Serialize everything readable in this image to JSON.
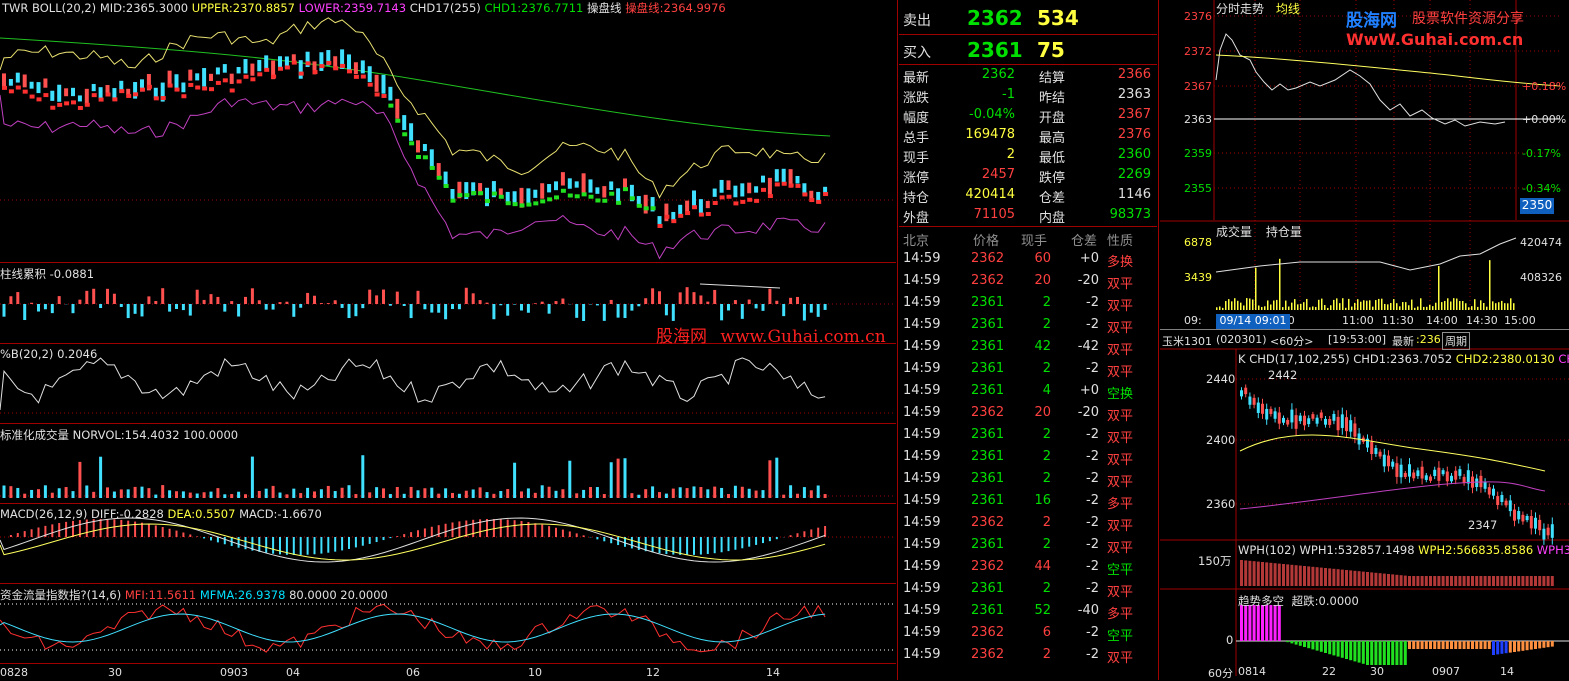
{
  "left_chart": {
    "boll_title": "TWR BOLL(20,2)",
    "mid": "MID:2365.3000",
    "upper": "UPPER:2370.8857",
    "lower": "LOWER:2359.7143",
    "chd": "CHD17(255)",
    "chd1": "CHD1:2376.7711",
    "op_line_label": "操盘线",
    "op_line_value": "操盘线:2364.9976",
    "vol_accum_label": "柱线累积",
    "vol_accum_value": "-0.0881",
    "pctb_label": "%B(20,2)",
    "pctb_value": "0.2046",
    "norvol_label": "标准化成交量",
    "norvol_value": "NORVOL:154.4032",
    "norvol_extra": "100.0000",
    "macd_label": "MACD(26,12,9)",
    "macd_diff": "DIFF:-0.2828",
    "macd_dea": "DEA:0.5507",
    "macd_val": "MACD:-1.6670",
    "mfi_label": "资金流量指数指?(14,6)",
    "mfi_value": "MFI:11.5611",
    "mfma_value": "MFMA:26.9378",
    "mfi_80": "80.0000",
    "mfi_20": "20.0000",
    "watermark_cn": "股海网",
    "watermark_url": "www.Guhai.com.cn",
    "x_labels": [
      "0828",
      "30",
      "0903",
      "04",
      "06",
      "10",
      "12",
      "14"
    ]
  },
  "quote": {
    "sell_label": "卖出",
    "sell_price": "2362",
    "sell_vol": "534",
    "buy_label": "买入",
    "buy_price": "2361",
    "buy_vol": "75",
    "rows": [
      {
        "l1": "最新",
        "v1": "2362",
        "l2": "结算",
        "v2": "2366"
      },
      {
        "l1": "涨跌",
        "v1": "-1",
        "l2": "昨结",
        "v2": "2363"
      },
      {
        "l1": "幅度",
        "v1": "-0.04%",
        "l2": "开盘",
        "v2": "2367"
      },
      {
        "l1": "总手",
        "v1": "169478",
        "l2": "最高",
        "v2": "2376"
      },
      {
        "l1": "现手",
        "v1": "2",
        "l2": "最低",
        "v2": "2360"
      },
      {
        "l1": "涨停",
        "v1": "2457",
        "l2": "跌停",
        "v2": "2269"
      },
      {
        "l1": "持仓",
        "v1": "420414",
        "l2": "仓差",
        "v2": "1146"
      },
      {
        "l1": "外盘",
        "v1": "71105",
        "l2": "内盘",
        "v2": "98373"
      }
    ],
    "tick_headers": [
      "北京",
      "价格",
      "现手",
      "仓差",
      "性质"
    ],
    "ticks": [
      {
        "t": "14:59",
        "p": "2362",
        "v": "60",
        "d": "+0",
        "n": "多换"
      },
      {
        "t": "14:59",
        "p": "2362",
        "v": "20",
        "d": "-20",
        "n": "双平"
      },
      {
        "t": "14:59",
        "p": "2361",
        "v": "2",
        "d": "-2",
        "n": "双平"
      },
      {
        "t": "14:59",
        "p": "2361",
        "v": "2",
        "d": "-2",
        "n": "双平"
      },
      {
        "t": "14:59",
        "p": "2361",
        "v": "42",
        "d": "-42",
        "n": "双平"
      },
      {
        "t": "14:59",
        "p": "2361",
        "v": "2",
        "d": "-2",
        "n": "双平"
      },
      {
        "t": "14:59",
        "p": "2361",
        "v": "4",
        "d": "+0",
        "n": "空换"
      },
      {
        "t": "14:59",
        "p": "2362",
        "v": "20",
        "d": "-20",
        "n": "双平"
      },
      {
        "t": "14:59",
        "p": "2361",
        "v": "2",
        "d": "-2",
        "n": "双平"
      },
      {
        "t": "14:59",
        "p": "2361",
        "v": "2",
        "d": "-2",
        "n": "双平"
      },
      {
        "t": "14:59",
        "p": "2361",
        "v": "2",
        "d": "-2",
        "n": "双平"
      },
      {
        "t": "14:59",
        "p": "2361",
        "v": "16",
        "d": "-2",
        "n": "多平"
      },
      {
        "t": "14:59",
        "p": "2362",
        "v": "2",
        "d": "-2",
        "n": "双平"
      },
      {
        "t": "14:59",
        "p": "2361",
        "v": "2",
        "d": "-2",
        "n": "双平"
      },
      {
        "t": "14:59",
        "p": "2362",
        "v": "44",
        "d": "-2",
        "n": "空平"
      },
      {
        "t": "14:59",
        "p": "2361",
        "v": "2",
        "d": "-2",
        "n": "双平"
      },
      {
        "t": "14:59",
        "p": "2361",
        "v": "52",
        "d": "-40",
        "n": "多平"
      },
      {
        "t": "14:59",
        "p": "2362",
        "v": "6",
        "d": "-2",
        "n": "空平"
      },
      {
        "t": "14:59",
        "p": "2362",
        "v": "2",
        "d": "-2",
        "n": "双平"
      }
    ]
  },
  "intraday": {
    "title": "分时走势",
    "avg_label": "均线",
    "prices": [
      "2376",
      "2372",
      "2367",
      "2363",
      "2359",
      "2355"
    ],
    "pcts": [
      "+0.18%",
      "+0.00%",
      "-0.17%",
      "-0.34%"
    ],
    "cursor_price": "2350",
    "logo_cn": "股海网",
    "logo_slogan": "股票软件资源分享",
    "logo_url": "WwW.Guhai.com.cn",
    "vol_title": "成交量",
    "oi_title": "持仓量",
    "vol_ticks": [
      "6878",
      "3439"
    ],
    "oi_ticks": [
      "420474",
      "408326"
    ],
    "time_labels": [
      "09:",
      "0:00",
      "11:00",
      "11:30",
      "14:00",
      "14:30",
      "15:00"
    ],
    "cursor_date": "09/14 09:01"
  },
  "kline": {
    "symbol": "玉米1301",
    "code": "(020301)",
    "period": "<60分>",
    "clock": "[19:53:00]",
    "latest_label": "最新",
    "latest_value": ":236",
    "period_btn": "周期",
    "k_label": "K",
    "chd": "CHD(17,102,255)",
    "chd1": "CHD1:2363.7052",
    "chd2": "CHD2:2380.0130",
    "chd3": "CH",
    "y_ticks": [
      "2440",
      "2400",
      "2360"
    ],
    "high_mark": "2442",
    "low_mark": "2347",
    "wph_label": "WPH(102)",
    "wph1": "WPH1:532857.1498",
    "wph2": "WPH2:566835.8586",
    "wph3": "WPH3",
    "wph_tick": "150万",
    "trend_label": "趋势多空",
    "super_label": "超跌:0.0000",
    "trend_zero": "0",
    "x_labels": [
      "60分",
      "0814",
      "22",
      "30",
      "0907",
      "14"
    ]
  }
}
